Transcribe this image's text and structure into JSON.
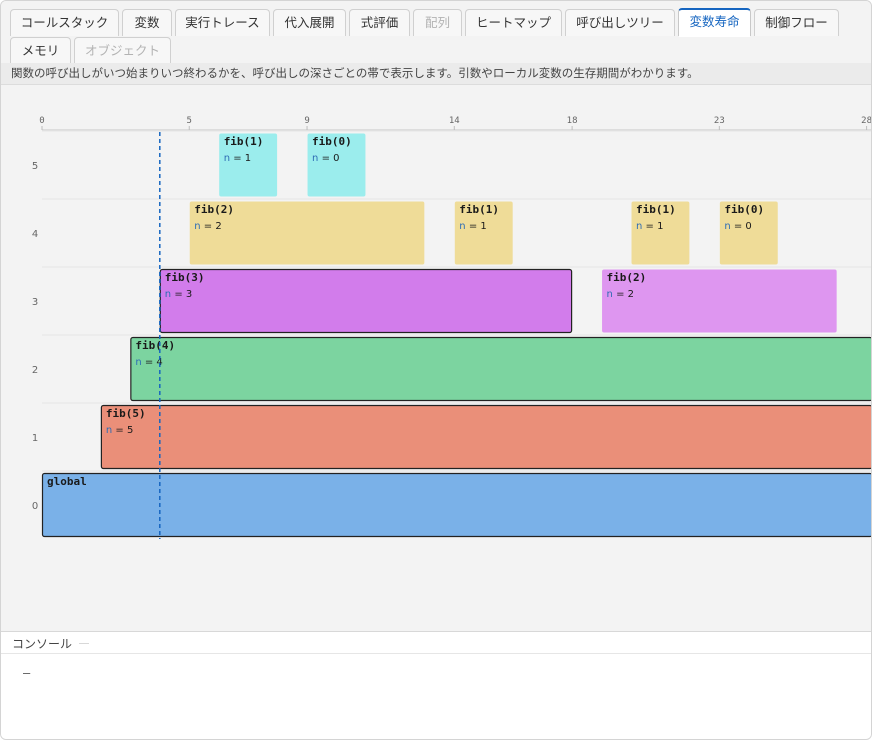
{
  "tabs": [
    {
      "label": "コールスタック",
      "state": "normal"
    },
    {
      "label": "変数",
      "state": "normal"
    },
    {
      "label": "実行トレース",
      "state": "normal"
    },
    {
      "label": "代入展開",
      "state": "normal"
    },
    {
      "label": "式評価",
      "state": "normal"
    },
    {
      "label": "配列",
      "state": "disabled"
    },
    {
      "label": "ヒートマップ",
      "state": "normal"
    },
    {
      "label": "呼び出しツリー",
      "state": "normal"
    },
    {
      "label": "変数寿命",
      "state": "active"
    },
    {
      "label": "制御フロー",
      "state": "normal"
    },
    {
      "label": "メモリ",
      "state": "normal"
    },
    {
      "label": "オブジェクト",
      "state": "disabled"
    }
  ],
  "description": "関数の呼び出しがいつ始まりいつ終わるかを、呼び出しの深さごとの帯で表示します。引数やローカル変数の生存期間がわかります。",
  "chart_data": {
    "type": "timeline",
    "x_ticks": [
      0,
      5,
      9,
      14,
      18,
      23,
      28
    ],
    "x_tick_labels": [
      "0",
      "5",
      "9",
      "14",
      "18",
      "23",
      "28"
    ],
    "y_levels": [
      0,
      1,
      2,
      3,
      4,
      5
    ],
    "y_tick_labels": [
      "0",
      "1",
      "2",
      "3",
      "4",
      "5"
    ],
    "current_step": 4,
    "frames": [
      {
        "name": "global",
        "depth": 0,
        "start": 0,
        "end": 28.2,
        "vars": [],
        "color": "#7ab1e8",
        "active": true
      },
      {
        "name": "fib(5)",
        "depth": 1,
        "start": 2,
        "end": 28.2,
        "vars": [
          {
            "name": "n",
            "value": "5"
          }
        ],
        "color": "#ea8f79",
        "active": true
      },
      {
        "name": "fib(4)",
        "depth": 2,
        "start": 3,
        "end": 28.2,
        "vars": [
          {
            "name": "n",
            "value": "4"
          }
        ],
        "color": "#7cd4a0",
        "active": true
      },
      {
        "name": "fib(3)",
        "depth": 3,
        "start": 4,
        "end": 18,
        "vars": [
          {
            "name": "n",
            "value": "3"
          }
        ],
        "color": "#d27ceb",
        "active": true
      },
      {
        "name": "fib(2)",
        "depth": 3,
        "start": 19,
        "end": 27,
        "vars": [
          {
            "name": "n",
            "value": "2"
          }
        ],
        "color": "#de96f0",
        "active": false
      },
      {
        "name": "fib(2)",
        "depth": 4,
        "start": 5,
        "end": 13,
        "vars": [
          {
            "name": "n",
            "value": "2"
          }
        ],
        "color": "#efdc98",
        "active": false
      },
      {
        "name": "fib(1)",
        "depth": 4,
        "start": 14,
        "end": 16,
        "vars": [
          {
            "name": "n",
            "value": "1"
          }
        ],
        "color": "#efdc98",
        "active": false
      },
      {
        "name": "fib(1)",
        "depth": 4,
        "start": 20,
        "end": 22,
        "vars": [
          {
            "name": "n",
            "value": "1"
          }
        ],
        "color": "#efdc98",
        "active": false
      },
      {
        "name": "fib(0)",
        "depth": 4,
        "start": 23,
        "end": 25,
        "vars": [
          {
            "name": "n",
            "value": "0"
          }
        ],
        "color": "#efdc98",
        "active": false
      },
      {
        "name": "fib(1)",
        "depth": 5,
        "start": 6,
        "end": 8,
        "vars": [
          {
            "name": "n",
            "value": "1"
          }
        ],
        "color": "#9beded",
        "active": false
      },
      {
        "name": "fib(0)",
        "depth": 5,
        "start": 9,
        "end": 11,
        "vars": [
          {
            "name": "n",
            "value": "0"
          }
        ],
        "color": "#9beded",
        "active": false
      }
    ],
    "colors": {
      "axis": "#dddddd",
      "tick_text": "#666666",
      "current_line": "#1565c0",
      "border_active": "#222222",
      "var_name": "#2f6db5",
      "text": "#1a1a1a"
    }
  },
  "console": {
    "title": "コンソール",
    "output": "—"
  }
}
